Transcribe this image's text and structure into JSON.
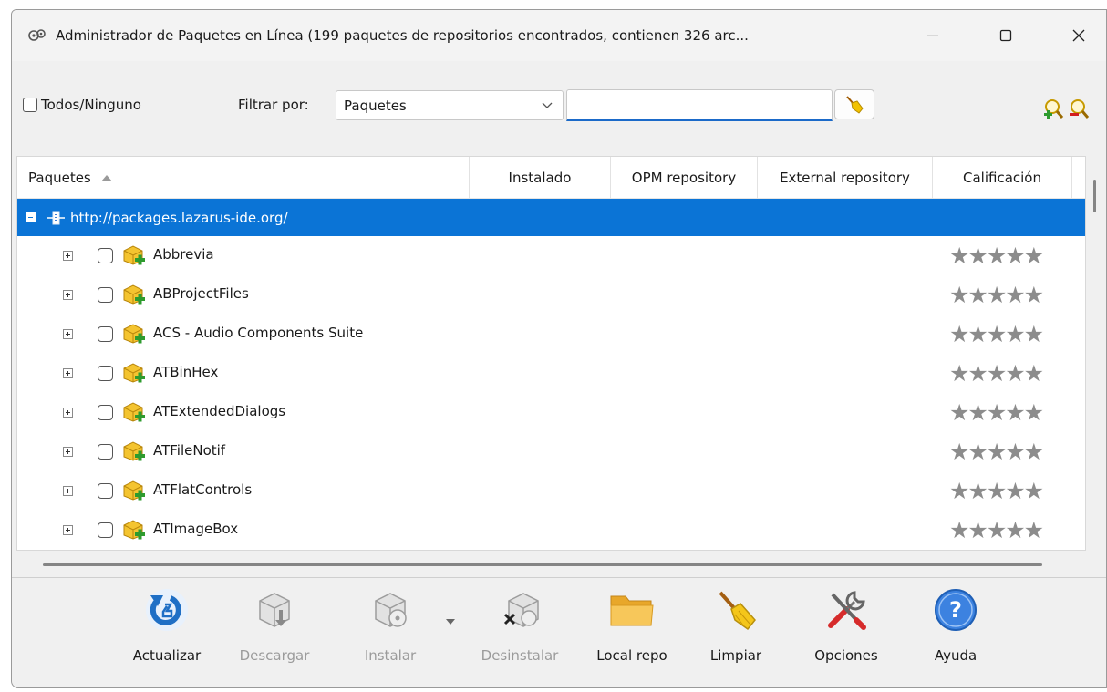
{
  "window": {
    "title": "Administrador de Paquetes en Línea (199 paquetes de repositorios encontrados, contienen 326 arc...",
    "controls": [
      "minimize",
      "maximize",
      "close"
    ]
  },
  "filter": {
    "all_none_label": "Todos/Ninguno",
    "filter_by_label": "Filtrar por:",
    "filter_select_value": "Paquetes",
    "search_value": ""
  },
  "grid": {
    "columns": [
      "Paquetes",
      "Instalado",
      "OPM repository",
      "External repository",
      "Calificación"
    ],
    "repository": "http://packages.lazarus-ide.org/",
    "packages": [
      {
        "name": "Abbrevia",
        "rating_glyphs": "★★★★★"
      },
      {
        "name": "ABProjectFiles",
        "rating_glyphs": "★★★★★"
      },
      {
        "name": "ACS - Audio Components Suite",
        "rating_glyphs": "★★★★★"
      },
      {
        "name": "ATBinHex",
        "rating_glyphs": "★★★★★"
      },
      {
        "name": "ATExtendedDialogs",
        "rating_glyphs": "★★★★★"
      },
      {
        "name": "ATFileNotif",
        "rating_glyphs": "★★★★★"
      },
      {
        "name": "ATFlatControls",
        "rating_glyphs": "★★★★★"
      },
      {
        "name": "ATImageBox",
        "rating_glyphs": "★★★★★"
      }
    ]
  },
  "toolbar": {
    "refresh": "Actualizar",
    "download": "Descargar",
    "install": "Instalar",
    "uninstall": "Desinstalar",
    "local_repo": "Local repo",
    "clean": "Limpiar",
    "options": "Opciones",
    "help": "Ayuda"
  },
  "colors": {
    "selection": "#0b74d6",
    "accent_underline": "#1b6ac9",
    "star_empty": "#8c8c8c"
  }
}
